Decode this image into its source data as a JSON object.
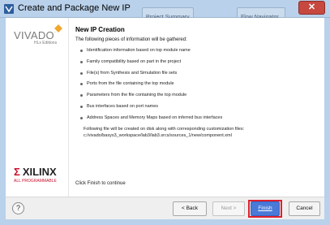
{
  "window": {
    "title": "Create and Package New IP",
    "close_symbol": "✕",
    "background_tabs": [
      "Project Summary",
      "Flow Navigator"
    ]
  },
  "brand": {
    "product_name": "VIVADO",
    "product_edition": "HLx Editions",
    "vendor_name": "XILINX",
    "vendor_tagline": "ALL PROGRAMMABLE"
  },
  "content": {
    "heading": "New IP Creation",
    "lead": "The following pieces of information will be gathered:",
    "items": [
      "Identification information based on top module name",
      "Family compatibility based on part in the project",
      "File(s) from Synthesis and Simulation file sets",
      "Ports from the file containing the top module",
      "Parameters from the file containing the top module",
      "Bus interfaces based on port names",
      "Address Spaces and Memory Maps based on inferred bus interfaces"
    ],
    "file_note": "Following file will be created on disk along with corresponding customization files:",
    "file_path": "c:/vivado/basys3_workspace/lab3/lab3.srcs/sources_1/new/component.xml",
    "finish_note": "Click Finish to continue"
  },
  "buttons": {
    "help": "?",
    "back": "< Back",
    "next": "Next >",
    "finish": "Finish",
    "cancel": "Cancel"
  },
  "colors": {
    "titlebar": "#b9d1ea",
    "close": "#c7483f",
    "finish_button": "#4a7ad8",
    "highlight": "#e0202a",
    "xilinx_red": "#c8102e"
  }
}
